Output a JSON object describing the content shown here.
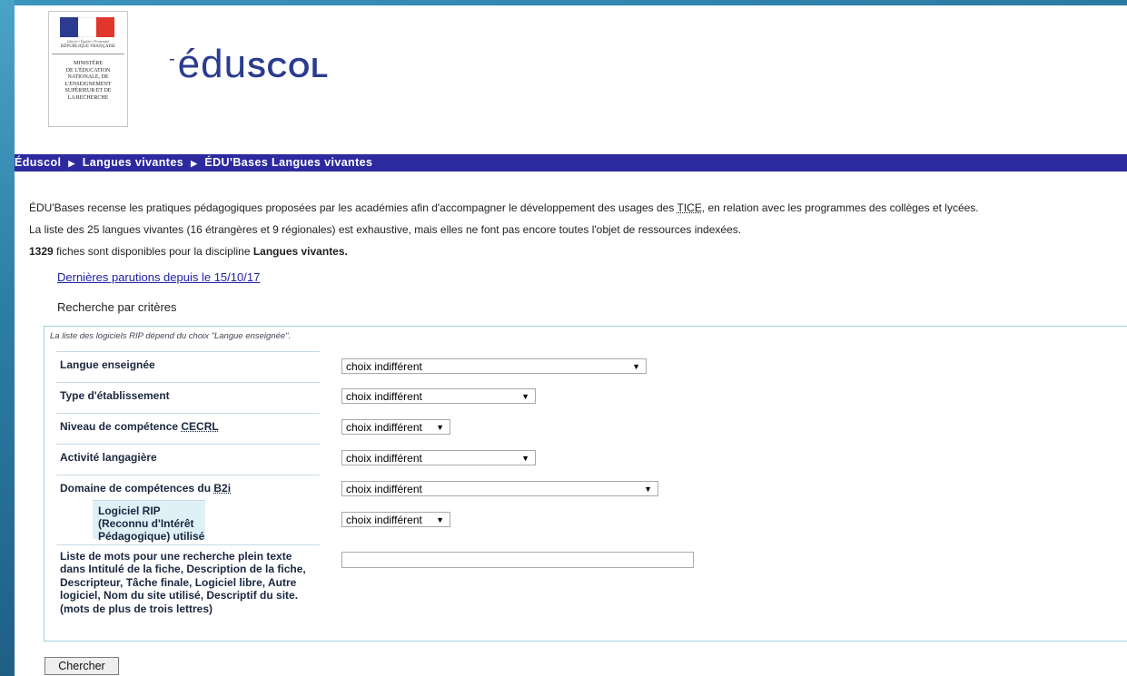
{
  "header": {
    "ministry_lines": [
      "Ministère",
      "de l'Éducation",
      "nationale, de",
      "l'Enseignement",
      "supérieur et de",
      "la Recherche"
    ],
    "motto": "Liberté • Égalité • Fraternité",
    "republique": "RÉPUBLIQUE FRANÇAISE",
    "site_logo_prefix": "édu",
    "site_logo_suffix": "scol"
  },
  "breadcrumb": {
    "items": [
      "Éduscol",
      "Langues vivantes",
      "ÉDU'Bases Langues vivantes"
    ]
  },
  "intro": {
    "line1_before": "ÉDU'Bases recense les pratiques pédagogiques proposées par les académies afin d'accompagner le développement des usages des ",
    "line1_abbr": "TICE",
    "line1_after": ", en relation avec les programmes des collèges et lycées.",
    "line2": "La liste des 25 langues vivantes (16 étrangères et 9 régionales) est exhaustive, mais elles ne font pas encore toutes l'objet de ressources indexées.",
    "line3_count": "1329",
    "line3_middle": " fiches sont disponibles pour la discipline ",
    "line3_discipline": "Langues vivantes."
  },
  "latest_link": "Dernières parutions depuis le 15/10/17",
  "search_heading": "Recherche par critères",
  "form": {
    "note": "La liste des logiciels RIP dépend du choix \"Langue enseignée\".",
    "fields": [
      {
        "label": "Langue enseignée",
        "value": "choix indifférent"
      },
      {
        "label": "Type d'établissement",
        "value": "choix indifférent"
      },
      {
        "label_before": "Niveau de compétence ",
        "label_abbr": "CECRL",
        "value": "choix indifférent"
      },
      {
        "label": "Activité langagière",
        "value": "choix indifférent"
      },
      {
        "label_before": "Domaine de compétences du ",
        "label_abbr": "B2i",
        "value": "choix indifférent"
      },
      {
        "label": "Logiciel RIP (Reconnu d'Intérêt Pédagogique) utilisé",
        "value": "choix indifférent"
      }
    ],
    "fulltext_label": "Liste de mots pour une recherche plein texte dans Intitulé de la fiche, Description de la fiche, Descripteur, Tâche finale, Logiciel libre, Autre logiciel, Nom du site utilisé, Descriptif du site. (mots de plus de trois lettres)",
    "fulltext_value": "",
    "dropdown_icon": "triangle-down-icon"
  },
  "submit_label": "Chercher",
  "colors": {
    "breadcrumb_bg": "#2d2aa0",
    "link": "#2020a8",
    "form_border": "#a6cfdf",
    "highlight_bg": "#dff1f7",
    "frame": "#2f7fa8"
  }
}
